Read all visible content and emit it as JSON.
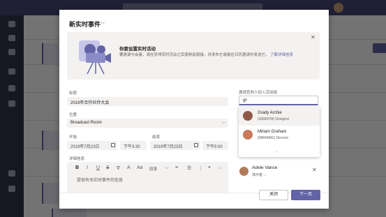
{
  "dialog": {
    "title": "新实时事件",
    "banner": {
      "heading": "你要设置实时活动",
      "body": "要邀请与会者，请在安排实时活动之后复制此链接，并发布它或者在日历邀请中发送它。",
      "link": "了解详细信息"
    },
    "title_field": {
      "label": "标题",
      "value": "2019年合作伙伴大会"
    },
    "location_field": {
      "label": "位置",
      "value": "Broadcast Room"
    },
    "start": {
      "label": "开始",
      "date": "2019年7月23日",
      "time": "下午3:30"
    },
    "end": {
      "label": "结束",
      "date": "2019年7月23日",
      "time": "下午5:00"
    },
    "details": {
      "label": "详细信息",
      "placeholder": "提供有关实时事件的信息"
    },
    "toolbar": {
      "bold": "B",
      "italic": "I",
      "underline": "U",
      "strike": "S",
      "format": "段落"
    },
    "invite": {
      "label": "邀请其他人加入活动组",
      "input_value": "gr",
      "suggestions": [
        {
          "name": "Grady Archie",
          "title": "(GRADYA) Designer",
          "color": "#8e5a48"
        },
        {
          "name": "Miriam Graham",
          "title": "(MIRIAMG) Director",
          "color": "#c97a5c"
        }
      ],
      "attendee": {
        "name": "Adele Vance",
        "role": "演示者"
      }
    },
    "buttons": {
      "back": "关闭",
      "next": "下一页"
    }
  }
}
